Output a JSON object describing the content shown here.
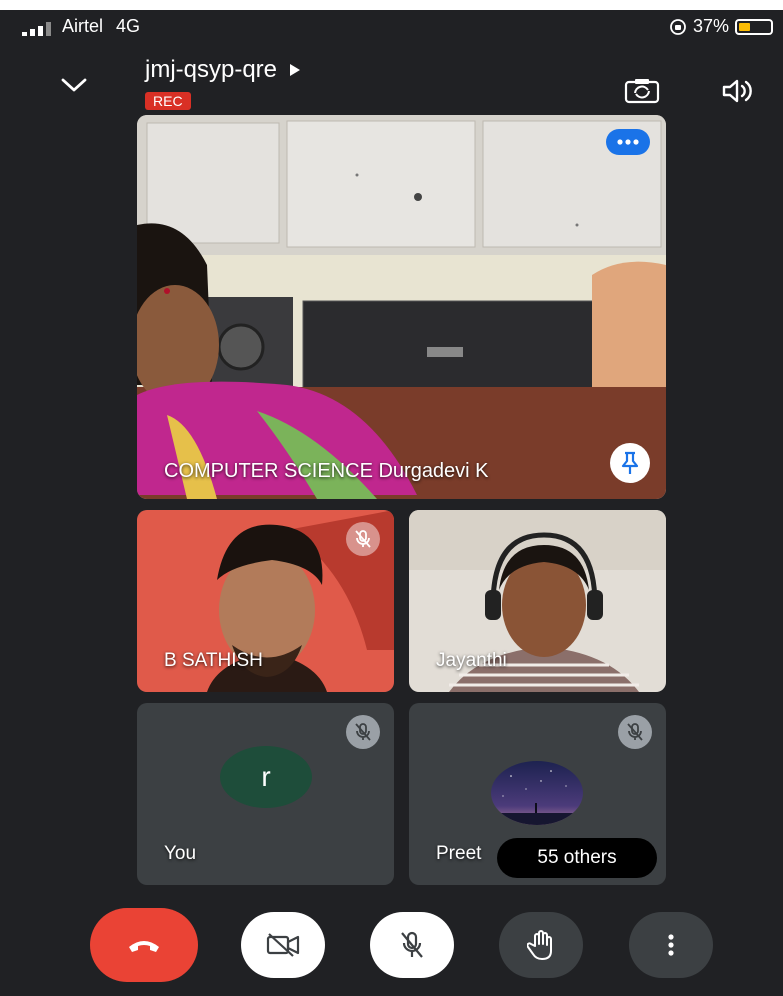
{
  "status_bar": {
    "carrier": "Airtel",
    "network": "4G",
    "battery": "37%",
    "battery_level": 0.37
  },
  "header": {
    "meeting_code": "jmj-qsyp-qre",
    "rec_label": "REC",
    "icons": [
      "chevron-down-icon",
      "play-arrow-icon",
      "flip-camera-icon",
      "speaker-icon"
    ]
  },
  "participants": {
    "main": {
      "name": "COMPUTER SCIENCE Durgadevi K"
    },
    "sathish": {
      "name": "B SATHISH"
    },
    "jayanthi": {
      "name": "Jayanthi"
    },
    "you": {
      "name": "You",
      "initial": "r"
    },
    "preet": {
      "name": "Preet"
    }
  },
  "others_label": "55 others",
  "controls": {
    "icons": [
      "end-call-icon",
      "camera-off-icon",
      "mic-off-icon",
      "raise-hand-icon",
      "more-vert-icon"
    ]
  },
  "colors": {
    "background": "#202124",
    "end_call": "#ea4335",
    "rec": "#d93025",
    "accent_blue": "#1a73e8"
  }
}
